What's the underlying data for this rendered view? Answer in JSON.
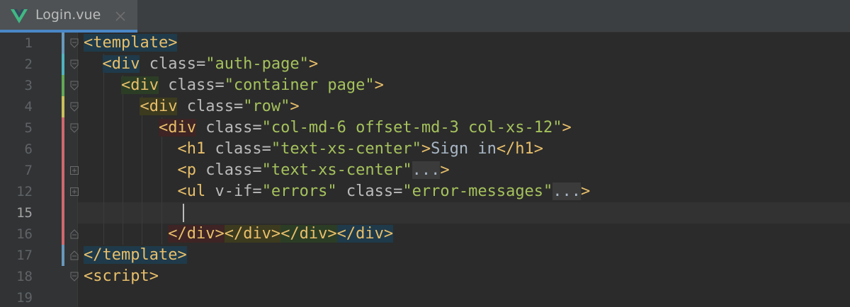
{
  "tab": {
    "title": "Login.vue",
    "icon": "vue-logo-icon",
    "accent": "#41b883"
  },
  "gutter": {
    "line_numbers": [
      "1",
      "2",
      "3",
      "4",
      "5",
      "6",
      "7",
      "12",
      "15",
      "16",
      "17",
      "18",
      "19"
    ],
    "active_line": "15"
  },
  "code": [
    {
      "t": "<template>"
    },
    {
      "indent": "  ",
      "t1": "<div",
      "a1": " class=",
      "s1": "\"auth-page\"",
      "t2": ">"
    },
    {
      "indent": "    ",
      "t1": "<div",
      "a1": " class=",
      "s1": "\"container page\"",
      "t2": ">"
    },
    {
      "indent": "      ",
      "t1": "<div",
      "a1": " class=",
      "s1": "\"row\"",
      "t2": ">"
    },
    {
      "indent": "        ",
      "t1": "<div",
      "a1": " class=",
      "s1": "\"col-md-6 offset-md-3 col-xs-12\"",
      "t2": ">"
    },
    {
      "indent": "          ",
      "t1": "<h1",
      "a1": " class=",
      "s1": "\"text-xs-center\"",
      "t2": ">",
      "txt": "Sign in",
      "t3": "</h1>"
    },
    {
      "indent": "          ",
      "t1": "<p",
      "a1": " class=",
      "s1": "\"text-xs-center\"",
      "ell": "...",
      "t2": ">"
    },
    {
      "indent": "          ",
      "t1": "<ul",
      "a1": " v-if=",
      "s1": "\"errors\"",
      "a2": " class=",
      "s2": "\"error-messages\"",
      "ell": "...",
      "t2": ">"
    },
    {
      "t": ""
    },
    {
      "indent": "         ",
      "c1": "</div>",
      "c2": "</div>",
      "c3": "</div>",
      "c4": "</div>"
    },
    {
      "t": "</template>"
    },
    {
      "t": "<script>"
    },
    {
      "t": ""
    }
  ],
  "colors": {
    "tag": "#e8bf6a",
    "attribute": "#bababa",
    "string": "#a5c25c",
    "text": "#a9b7c6",
    "background": "#2b2b2b"
  }
}
